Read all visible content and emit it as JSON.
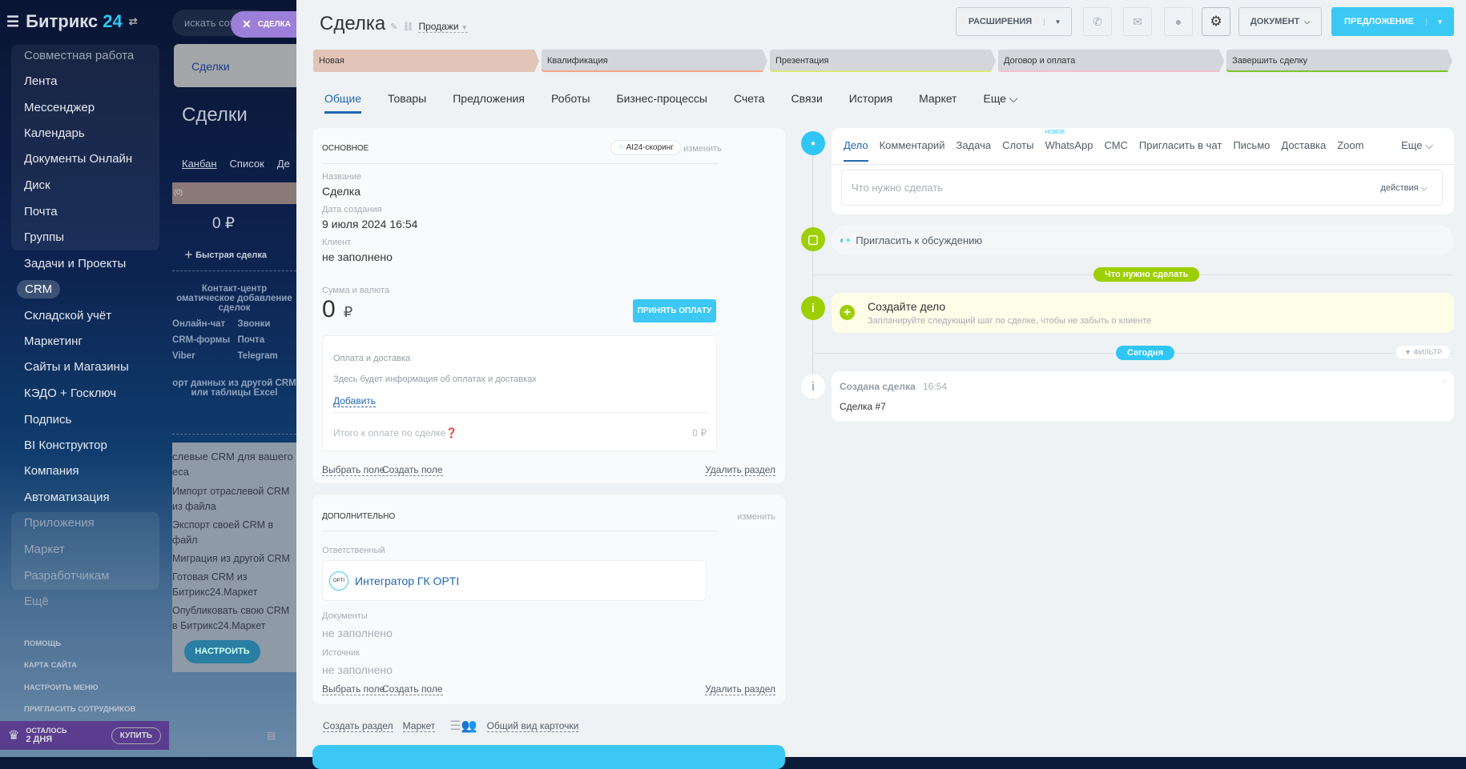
{
  "sidebar": {
    "logo": "Битрикс",
    "logo_num": "24",
    "group_header": "Совместная работа",
    "items": [
      "Лента",
      "Мессенджер",
      "Календарь",
      "Документы Онлайн",
      "Диск",
      "Почта",
      "Группы",
      "Задачи и Проекты",
      "CRM",
      "Складской учёт",
      "Маркетинг",
      "Сайты и Магазины",
      "КЭДО + Госключ",
      "Подпись",
      "BI Конструктор",
      "Компания",
      "Автоматизация"
    ],
    "apps_header": "Приложения",
    "apps": [
      "Маркет",
      "Разработчикам"
    ],
    "more": "Ещё",
    "bottom": [
      "ПОМОЩЬ",
      "КАРТА САЙТА",
      "НАСТРОИТЬ МЕНЮ",
      "ПРИГЛАСИТЬ СОТРУДНИКОВ"
    ],
    "trial_label": "ОСТАЛОСЬ",
    "trial_days": "2 ДНЯ",
    "buy": "КУПИТЬ"
  },
  "crm_bg": {
    "search": "искать сотр",
    "tab": "Сделки",
    "title": "Сделки",
    "views": [
      "Канбан",
      "Список",
      "Де"
    ],
    "col": "(0)",
    "sum": "0 ₽",
    "quick": "Быстрая сделка",
    "cc_title": "Контакт-центр",
    "cc_sub": "оматическое добавление сделок",
    "channels": [
      "Онлайн-чат",
      "Звонки",
      "CRM-формы",
      "Почта",
      "Viber",
      "Telegram"
    ],
    "import": "орт данных из другой CRM или таблицы Excel",
    "crm_title": "слевые CRM для вашего еса",
    "crm_items": [
      "Импорт отраслевой CRM из файла",
      "Экспорт своей CRM в файл",
      "Миграция из другой CRM",
      "Готовая CRM из Битрикс24.Маркет",
      "Опубликовать свою CRM в Битрикс24.Маркет"
    ],
    "setup": "НАСТРОИТЬ"
  },
  "slider_tab": "СДЕЛКА",
  "header": {
    "title": "Сделка",
    "category": "Продажи",
    "extensions": "РАСШИРЕНИЯ",
    "document": "ДОКУМЕНТ",
    "offer": "ПРЕДЛОЖЕНИЕ"
  },
  "stages": [
    {
      "label": "Новая",
      "color": "#e2c4b8",
      "line": "#e2c4b8"
    },
    {
      "label": "Квалификация",
      "color": "#d3d6da",
      "line": "#f5a38a"
    },
    {
      "label": "Презентация",
      "color": "#d3d6da",
      "line": "#d8e77a"
    },
    {
      "label": "Договор и оплата",
      "color": "#d3d6da",
      "line": "#f5bfd0"
    },
    {
      "label": "Завершить сделку",
      "color": "#d3d6da",
      "line": "#7bc625"
    }
  ],
  "tabs": [
    "Общие",
    "Товары",
    "Предложения",
    "Роботы",
    "Бизнес-процессы",
    "Счета",
    "Связи",
    "История",
    "Маркет",
    "Еще"
  ],
  "main": {
    "title": "ОСНОВНОЕ",
    "ai": "AI24-скоринг",
    "edit": "изменить",
    "fields": [
      {
        "label": "Название",
        "value": "Сделка"
      },
      {
        "label": "Дата создания",
        "value": "9 июля 2024 16:54"
      },
      {
        "label": "Клиент",
        "value": "не заполнено"
      }
    ],
    "sum_label": "Сумма и валюта",
    "sum": "0",
    "currency": "₽",
    "pay_btn": "ПРИНЯТЬ ОПЛАТУ",
    "pay_title": "Оплата и доставка",
    "pay_info": "Здесь будет информация об оплатах и доставках",
    "add": "Добавить",
    "total_label": "Итого к оплате по сделке",
    "total": "0 ₽",
    "choose": "Выбрать поле",
    "create": "Создать поле",
    "delete": "Удалить раздел"
  },
  "extra": {
    "title": "ДОПОЛНИТЕЛЬНО",
    "edit": "изменить",
    "resp_label": "Ответственный",
    "resp": "Интегратор ГК OPTI",
    "docs_label": "Документы",
    "docs": "не заполнено",
    "src_label": "Источник",
    "src": "не заполнено",
    "choose": "Выбрать поле",
    "create": "Создать поле",
    "delete": "Удалить раздел"
  },
  "bottom_links": [
    "Создать раздел",
    "Маркет",
    "Общий вид карточки"
  ],
  "timeline": {
    "tabs": [
      "Дело",
      "Комментарий",
      "Задача",
      "Слоты",
      "WhatsApp",
      "СМС",
      "Пригласить в чат",
      "Письмо",
      "Доставка",
      "Zoom"
    ],
    "more": "Еще",
    "new_badge": "НОВОЕ",
    "placeholder": "Что нужно сделать",
    "actions": "действия",
    "invite": "Пригласить к обсуждению",
    "todo_pill": "Что нужно сделать",
    "create_title": "Создайте дело",
    "create_sub": "Запланируйте следующий шаг по сделке, чтобы не забыть о клиенте",
    "today": "Сегодня",
    "filter": "ФИЛЬТР",
    "event_title": "Создана сделка",
    "event_time": "16:54",
    "event_text": "Сделка #7"
  }
}
